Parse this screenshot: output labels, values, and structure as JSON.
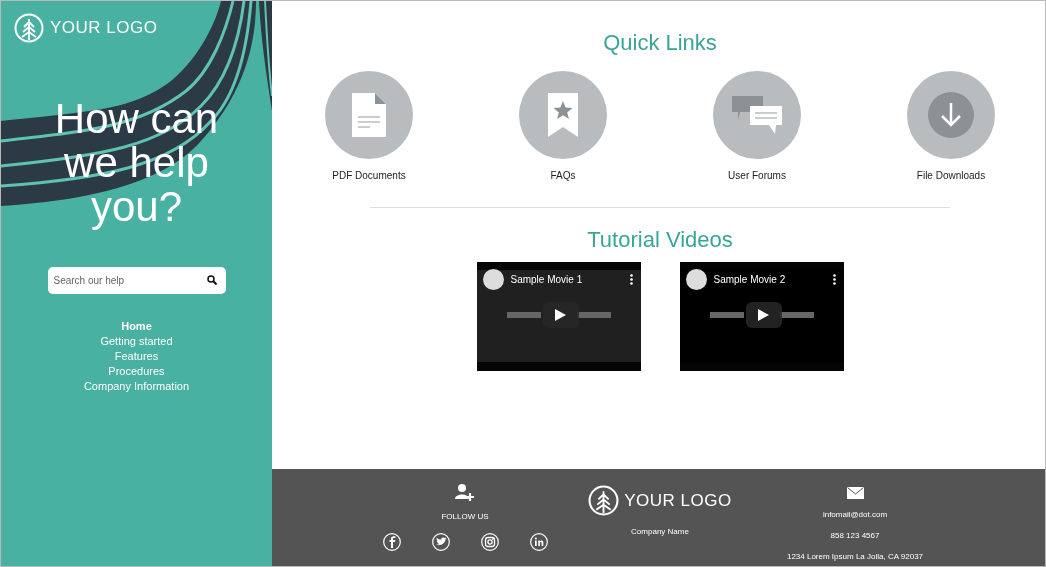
{
  "sidebar": {
    "logo": "YOUR LOGO",
    "headline": "How can we help you?",
    "search": {
      "placeholder": "Search our help"
    },
    "nav": [
      {
        "label": "Home",
        "selected": true
      },
      {
        "label": "Getting started",
        "selected": false
      },
      {
        "label": "Features",
        "selected": false
      },
      {
        "label": "Procedures",
        "selected": false
      },
      {
        "label": "Company Information",
        "selected": false
      }
    ]
  },
  "quick_links": {
    "title": "Quick Links",
    "items": [
      {
        "kind": "document",
        "label": "PDF Documents"
      },
      {
        "kind": "bookmark",
        "label": "FAQs"
      },
      {
        "kind": "chat",
        "label": "User Forums"
      },
      {
        "kind": "download",
        "label": "File Downloads"
      }
    ]
  },
  "tutorial_videos": {
    "title": "Tutorial Videos",
    "videos": [
      {
        "title": "Sample Movie 1"
      },
      {
        "title": "Sample Movie 2"
      }
    ]
  },
  "footer": {
    "follow_label": "FOLLOW US",
    "social": [
      {
        "kind": "facebook"
      },
      {
        "kind": "twitter"
      },
      {
        "kind": "instagram"
      },
      {
        "kind": "linkedin"
      }
    ],
    "logo": "YOUR LOGO",
    "company": "Company Name",
    "email": "infomail@dot.com",
    "phone": "858 123 4567",
    "address": "1234 Lorem Ipsum La Jolla, CA 92037"
  }
}
